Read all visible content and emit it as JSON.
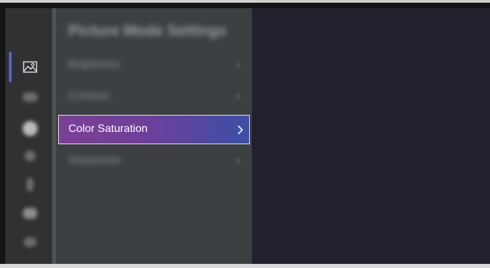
{
  "rail": {
    "icons": [
      "picture-icon",
      "sound-icon",
      "display-icon",
      "network-icon",
      "bluetooth-icon",
      "device-icon",
      "system-icon"
    ],
    "accent_color": "#5a61d6"
  },
  "panel": {
    "title": "Picture Mode Settings",
    "items": [
      {
        "label": "Brightness",
        "selected": false
      },
      {
        "label": "Contrast",
        "selected": false
      },
      {
        "label": "Color Saturation",
        "selected": true
      },
      {
        "label": "Sharpness",
        "selected": false
      }
    ]
  },
  "colors": {
    "selected_gradient_start": "#7c3f96",
    "selected_gradient_end": "#3c4fa6",
    "preview_background": "#221f2e"
  }
}
